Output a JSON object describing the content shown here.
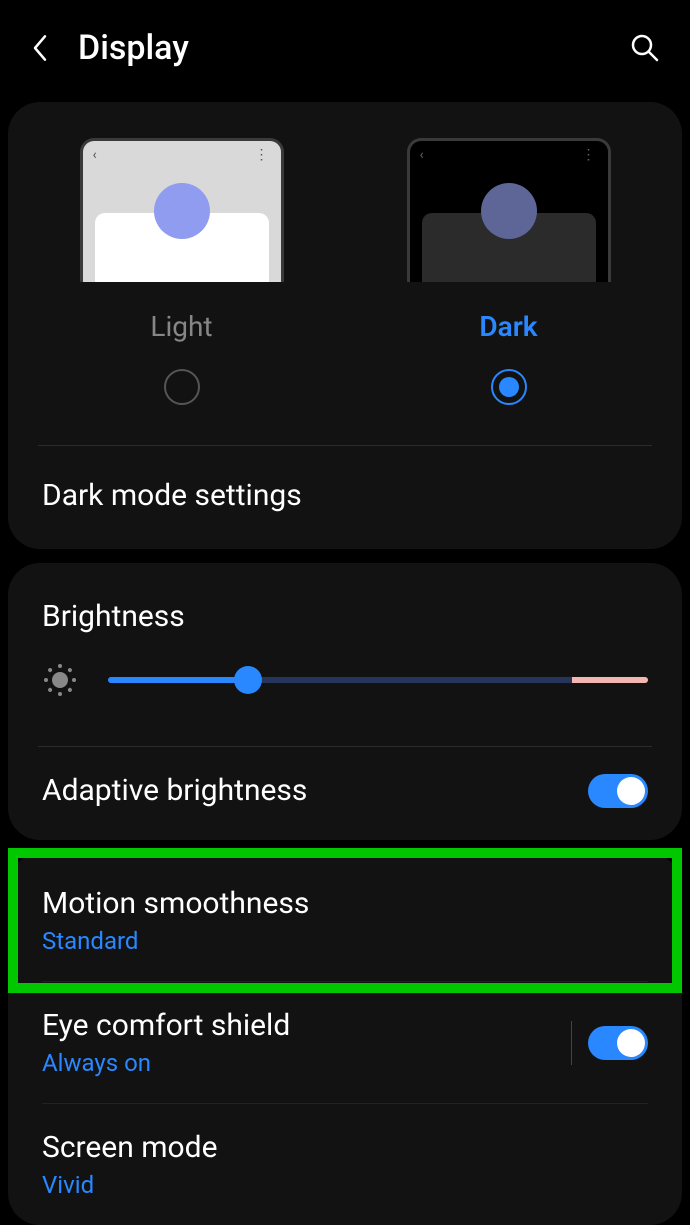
{
  "header": {
    "title": "Display"
  },
  "theme": {
    "light_label": "Light",
    "dark_label": "Dark",
    "selected": "dark",
    "dark_mode_settings": "Dark mode settings"
  },
  "brightness": {
    "title": "Brightness",
    "level_percent": 26,
    "adaptive_label": "Adaptive brightness",
    "adaptive_on": true
  },
  "settings": {
    "motion_title": "Motion smoothness",
    "motion_value": "Standard",
    "eye_title": "Eye comfort shield",
    "eye_value": "Always on",
    "eye_on": true,
    "screen_mode_title": "Screen mode",
    "screen_mode_value": "Vivid"
  },
  "highlight": {
    "target": "motion_smoothness"
  }
}
